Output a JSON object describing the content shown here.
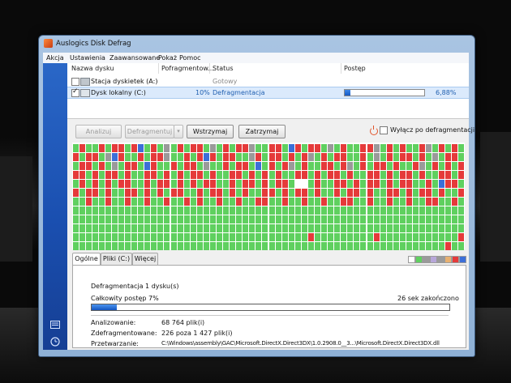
{
  "window": {
    "title": "Auslogics Disk Defrag"
  },
  "menu": [
    "Akcja",
    "Ustawienia",
    "Zaawansowane",
    "Pokaż",
    "Pomoc"
  ],
  "drive_list": {
    "columns": [
      "Nazwa dysku",
      "Pofragmentow...",
      "Status",
      "Postęp"
    ],
    "rows": [
      {
        "checked": false,
        "name": "Stacja dyskietek (A:)",
        "fragmented": "",
        "status": "Gotowy",
        "progress_text": "",
        "progress": 0
      },
      {
        "checked": true,
        "name": "Dysk lokalny (C:)",
        "fragmented": "10%",
        "status": "Defragmentacja",
        "progress_text": "6,88%",
        "progress": 0.0688
      }
    ]
  },
  "toolbar": {
    "analyze_label": "Analizuj",
    "defrag_label": "Defragmentuj",
    "pause_label": "Wstrzymaj",
    "stop_label": "Zatrzymaj",
    "shutdown_label": "Wyłącz po defragmentacji",
    "shutdown_checked": false
  },
  "cluster_map": {
    "columns": 60,
    "rows": 12,
    "colors": {
      "G": "#5fd05f",
      "R": "#e53a3a",
      "B": "#3c6fd8",
      "A": "#9a9a9a",
      "W": "#ffffff",
      "Y": "#e8b830"
    },
    "map": [
      "GRGGRGRRGRBGRGAGRGRRGAGRGRRAGGRRGBRGRRGAGRGGRRAGRGRGGRAGRGRG",
      "RGRRGABRGGRGRRAGGRGRBRGRRGGARGRRGRGRAGRGRRGGRGAGRGRRGRGAGRRG",
      "GRRGRGAGRRGBRGGRGRRGAGGRGRRGBGRGRAGRGGRRGRAGRGRRGRGGRAGRGRGR",
      "RRGRGRRGRGGRRGRGRGRRGRGGRRGRGRGRGGRRGRGRRGRGGRRGRGRRGRGGRRGR",
      "GRGRGRGRRGGRGRRGRGRGRRGGRGRRGRGRRGWWGRGGRRGRGRRGRGRRGGRGBRRG",
      "RGRRGRGGRRGRGRGRRGGRGRRGRGRGGRRGRGRRGRGGRGRRGRGGRRGRGRRGRGGR",
      "GGRGGRGGRGGRGGRGGRGRGGRGGRGGRRGGRGGRGGRGGRRGGRGGRGGRGGRRGGRG",
      "GGGGGGGGGGGGGGGGGGGGGGGGGGGGGGGGGGGGGGGGGGGGGGGGGGGGGGGGGGGG",
      "GGGGGGGGGGGGGGGGGGGGGGGGGGGGGGGGGGGGGGGGGGGGGGGGGGGGGGGGGGGG",
      "GGGGGGGGGGGGGGGGGGGGGGGGGGGGGGGGGGGGGGGGGGGGGGGGGGGGGGGGGGGG",
      "GGGGGGGGGGGGGGGGGGGGGGGGGGGGGGGGGGGGRGGGGGGGGGRGGGGGGGGGGGGR",
      "GGGGGGGGGGGGGGGGGGGGGGGGGGGGGGGGGGGGGGGGGGGGGGGGGGGGGGGGGRGG"
    ]
  },
  "tabs": [
    "Ogólne",
    "Pliki (C:)",
    "Więcej"
  ],
  "legend_colors": [
    "#ffffff",
    "#5fd05f",
    "#9a9a9a",
    "#b7a6d9",
    "#9a9a9a",
    "#e8b070",
    "#e53a3a",
    "#3c6fd8"
  ],
  "general": {
    "heading": "Defragmentacja 1 dysku(s)",
    "total_progress_label": "Całkowity postęp 7%",
    "total_progress": 0.07,
    "time_label": "26 sek zakończono",
    "details": [
      {
        "label": "Analizowanie:",
        "value": "68 764 plik(i)"
      },
      {
        "label": "Zdefragmentowane:",
        "value": "226 poza 1 427 plik(i)"
      },
      {
        "label": "Przetwarzanie:",
        "value": "C:\\Windows\\assembly\\GAC\\Microsoft.DirectX.Direct3DX\\1.0.2908.0__3...\\Microsoft.DirectX.Direct3DX.dll"
      }
    ]
  }
}
